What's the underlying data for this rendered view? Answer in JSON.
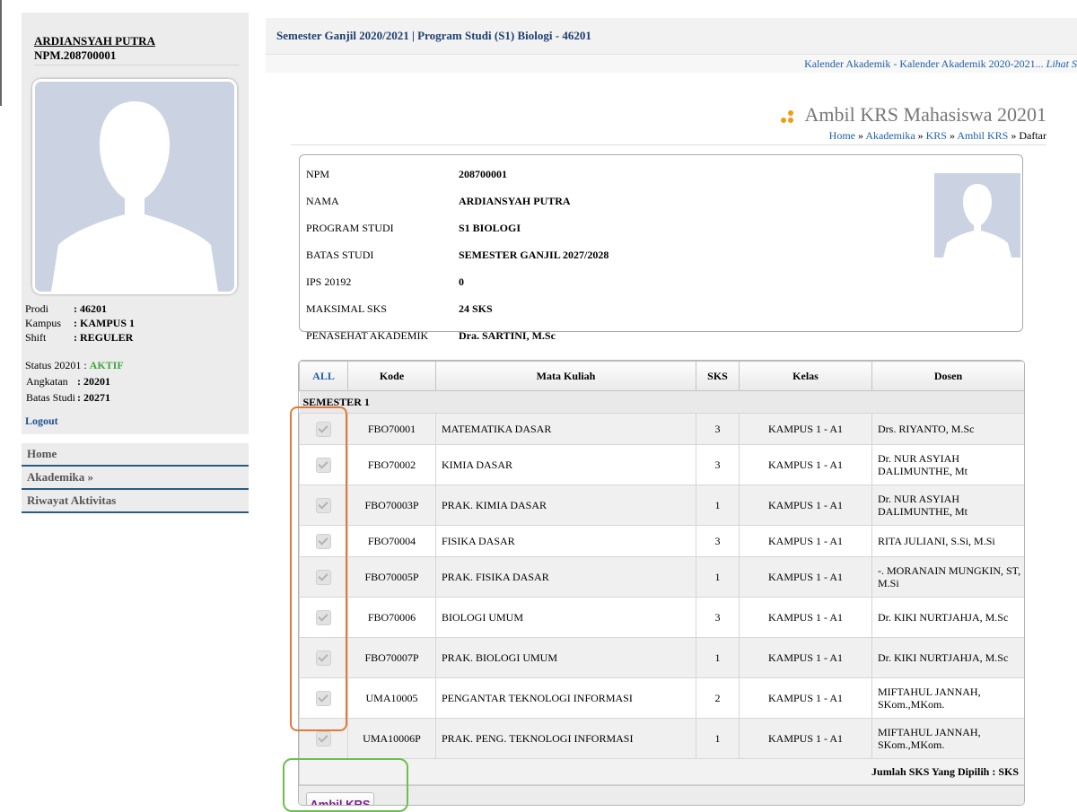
{
  "sidebar": {
    "name": "ARDIANSYAH PUTRA",
    "npm": "NPM.208700001",
    "info": [
      {
        "label": "Prodi",
        "value": ": 46201"
      },
      {
        "label": "Kampus",
        "value": ": KAMPUS 1"
      },
      {
        "label": "Shift",
        "value": ": REGULER"
      }
    ],
    "status_label": "Status 20201 :",
    "status_value": "AKTIF",
    "status_color": "#3fa63f",
    "info2": [
      {
        "label": "Angkatan",
        "value": ": 20201"
      },
      {
        "label": "Batas Studi",
        "value": ": 20271"
      }
    ],
    "logout": "Logout",
    "menu": [
      "Home",
      "Akademika »",
      "Riwayat Aktivitas"
    ]
  },
  "header": {
    "title": "Semester Ganjil 2020/2021 | Program Studi (S1) Biologi - 46201",
    "calendar_text": "Kalender Akademik - Kalender Akademik 2020-2021... ",
    "calendar_link": "Lihat S"
  },
  "page": {
    "title": "Ambil KRS Mahasiswa 20201",
    "breadcrumb": {
      "home": "Home",
      "sep": " » ",
      "akademika": "Akademika",
      "krs": "KRS",
      "ambil": "Ambil KRS",
      "current": "Daftar"
    }
  },
  "student": {
    "rows": [
      {
        "label": "NPM",
        "value": "208700001"
      },
      {
        "label": "NAMA",
        "value": "ARDIANSYAH PUTRA"
      },
      {
        "label": "PROGRAM STUDI",
        "value": "S1 BIOLOGI"
      },
      {
        "label": "BATAS STUDI",
        "value": "SEMESTER GANJIL 2027/2028"
      },
      {
        "label": "IPS 20192",
        "value": "0"
      },
      {
        "label": "MAKSIMAL SKS",
        "value": "24 SKS"
      },
      {
        "label": "PENASEHAT AKADEMIK",
        "value": "Dra. SARTINI, M.Sc"
      }
    ]
  },
  "krs": {
    "headers": {
      "all": "ALL",
      "kode": "Kode",
      "mata_kuliah": "Mata Kuliah",
      "sks": "SKS",
      "kelas": "Kelas",
      "dosen": "Dosen"
    },
    "semester_label": "SEMESTER 1",
    "rows": [
      {
        "kode": "FBO70001",
        "mk": "MATEMATIKA DASAR",
        "sks": "3",
        "kelas": "KAMPUS 1 - A1",
        "dosen": "Drs. RIYANTO, M.Sc",
        "checked": true
      },
      {
        "kode": "FBO70002",
        "mk": "KIMIA DASAR",
        "sks": "3",
        "kelas": "KAMPUS 1 - A1",
        "dosen": "Dr. NUR ASYIAH DALIMUNTHE, Mt",
        "checked": true
      },
      {
        "kode": "FBO70003P",
        "mk": "PRAK. KIMIA DASAR",
        "sks": "1",
        "kelas": "KAMPUS 1 - A1",
        "dosen": "Dr. NUR ASYIAH DALIMUNTHE, Mt",
        "checked": true
      },
      {
        "kode": "FBO70004",
        "mk": "FISIKA DASAR",
        "sks": "3",
        "kelas": "KAMPUS 1 - A1",
        "dosen": "RITA JULIANI, S.Si, M.Si",
        "checked": true
      },
      {
        "kode": "FBO70005P",
        "mk": "PRAK. FISIKA DASAR",
        "sks": "1",
        "kelas": "KAMPUS 1 - A1",
        "dosen": "-. MORANAIN MUNGKIN, ST, M.Si",
        "checked": true
      },
      {
        "kode": "FBO70006",
        "mk": "BIOLOGI UMUM",
        "sks": "3",
        "kelas": "KAMPUS 1 - A1",
        "dosen": "Dr. KIKI NURTJAHJA, M.Sc",
        "checked": true
      },
      {
        "kode": "FBO70007P",
        "mk": "PRAK. BIOLOGI UMUM",
        "sks": "1",
        "kelas": "KAMPUS 1 - A1",
        "dosen": "Dr. KIKI NURTJAHJA, M.Sc",
        "checked": true
      },
      {
        "kode": "UMA10005",
        "mk": "PENGANTAR TEKNOLOGI INFORMASI",
        "sks": "2",
        "kelas": "KAMPUS 1 - A1",
        "dosen": "MIFTAHUL JANNAH, SKom.,MKom.",
        "checked": true
      },
      {
        "kode": "UMA10006P",
        "mk": "PRAK. PENG. TEKNOLOGI INFORMASI",
        "sks": "1",
        "kelas": "KAMPUS 1 - A1",
        "dosen": "MIFTAHUL JANNAH, SKom.,MKom.",
        "checked": true
      }
    ],
    "total_label": "Jumlah SKS Yang Dipilih : SKS",
    "submit_label": "Ambil KRS"
  },
  "colors": {
    "link": "#1f5fa8",
    "accent_orange": "#f39c12",
    "highlight_checkbox_column": "#e07a3b",
    "highlight_submit_button": "#6cbf4e",
    "button_text": "#7a1f8c"
  }
}
